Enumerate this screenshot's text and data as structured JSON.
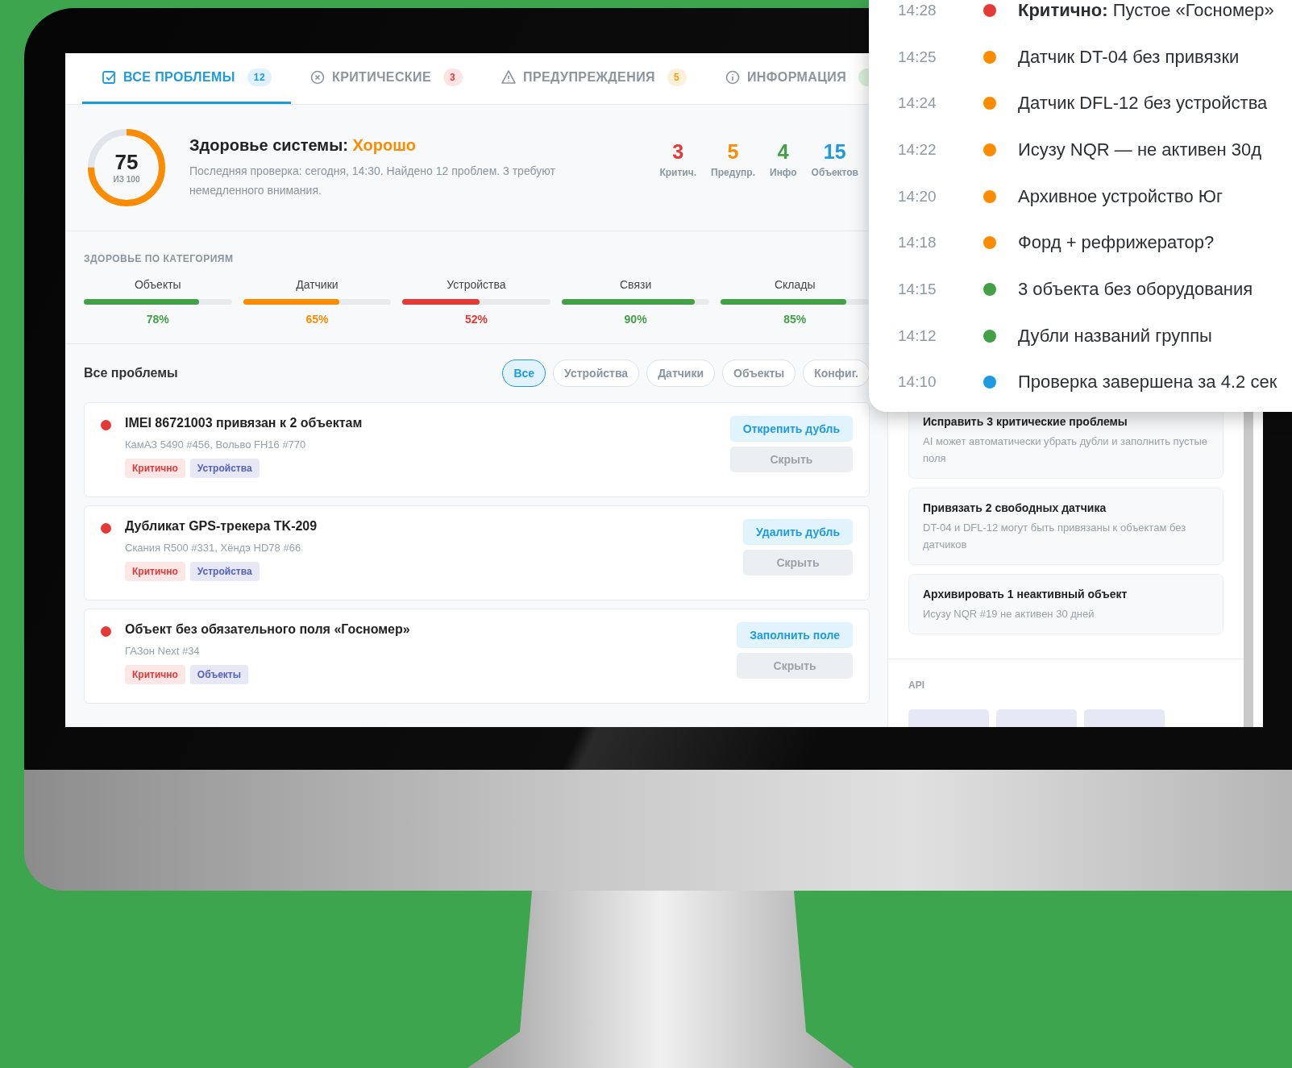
{
  "tabs": [
    {
      "label": "ВСЕ ПРОБЛЕМЫ",
      "count": "12",
      "kind": "all",
      "selected": true
    },
    {
      "label": "КРИТИЧЕСКИЕ",
      "count": "3",
      "kind": "critical",
      "selected": false
    },
    {
      "label": "ПРЕДУПРЕЖДЕНИЯ",
      "count": "5",
      "kind": "warning",
      "selected": false
    },
    {
      "label": "ИНФОРМАЦИЯ",
      "kind": "info",
      "selected": false
    }
  ],
  "health": {
    "score": "75",
    "score_caption": "ИЗ 100",
    "level": 0.75,
    "title": "Здоровье системы:",
    "status": "Хорошо",
    "description": "Последняя проверка: сегодня, 14:30. Найдено 12 проблем. 3 требуют немедленного внимания.",
    "stats": [
      {
        "value": "3",
        "label": "Критич.",
        "color": "#e53935"
      },
      {
        "value": "5",
        "label": "Предупр.",
        "color": "#fb8c00"
      },
      {
        "value": "4",
        "label": "Инфо",
        "color": "#43a047"
      },
      {
        "value": "15",
        "label": "Объектов",
        "color": "#1e9be0"
      }
    ]
  },
  "categories": {
    "title": "ЗДОРОВЬЕ ПО КАТЕГОРИЯМ",
    "items": [
      {
        "name": "Объекты",
        "level": 0.78,
        "reading": "78%",
        "color": "#43a047"
      },
      {
        "name": "Датчики",
        "level": 0.65,
        "reading": "65%",
        "color": "#fb8c00"
      },
      {
        "name": "Устройства",
        "level": 0.52,
        "reading": "52%",
        "color": "#e53935"
      },
      {
        "name": "Связи",
        "level": 0.9,
        "reading": "90%",
        "color": "#43a047"
      },
      {
        "name": "Склады",
        "level": 0.85,
        "reading": "85%",
        "color": "#43a047"
      }
    ]
  },
  "issues": {
    "title": "Все проблемы",
    "filters": [
      {
        "label": "Все",
        "selected": true
      },
      {
        "label": "Устройства",
        "selected": false
      },
      {
        "label": "Датчики",
        "selected": false
      },
      {
        "label": "Объекты",
        "selected": false
      },
      {
        "label": "Конфиг.",
        "selected": false
      }
    ],
    "items": [
      {
        "title": "IMEI 86721003 привязан к 2 объектам",
        "subtitle": "КамАЗ 5490 #456, Вольво FH16 #770",
        "color": "#e53935",
        "tags": [
          {
            "label": "Критично",
            "kind": "severity"
          },
          {
            "label": "Устройства",
            "kind": "category"
          }
        ],
        "primary_action": "Открепить дубль",
        "secondary_action": "Скрыть"
      },
      {
        "title": "Дубликат GPS-трекера TK-209",
        "subtitle": "Скания R500 #331, Хёндэ HD78 #66",
        "color": "#e53935",
        "tags": [
          {
            "label": "Критично",
            "kind": "severity"
          },
          {
            "label": "Устройства",
            "kind": "category"
          }
        ],
        "primary_action": "Удалить дубль",
        "secondary_action": "Скрыть"
      },
      {
        "title": "Объект без обязательного поля «Госномер»",
        "subtitle": "ГАЗон Next #34",
        "color": "#e53935",
        "tags": [
          {
            "label": "Критично",
            "kind": "severity"
          },
          {
            "label": "Объекты",
            "kind": "category"
          }
        ],
        "primary_action": "Заполнить поле",
        "secondary_action": "Скрыть"
      }
    ]
  },
  "sidebar": {
    "suggestions": [
      {
        "title": "Исправить 3 критические проблемы",
        "description": "AI может автоматически убрать дубли и заполнить пустые поля"
      },
      {
        "title": "Привязать 2 свободных датчика",
        "description": "DT-04 и DFL-12 могут быть привязаны к объектам без датчиков"
      },
      {
        "title": "Архивировать 1 неактивный объект",
        "description": "Исузу NQR #19 не активен 30 дней"
      }
    ],
    "api_title": "API"
  },
  "timeline": [
    {
      "time": "14:28",
      "color": "#e53935",
      "text": "**Критично:** Пустое «Госномер»"
    },
    {
      "time": "14:25",
      "color": "#fb8c00",
      "text": "Датчик DT-04 без привязки"
    },
    {
      "time": "14:24",
      "color": "#fb8c00",
      "text": "Датчик DFL-12 без устройства"
    },
    {
      "time": "14:22",
      "color": "#fb8c00",
      "text": "Исузу NQR — не активен 30д"
    },
    {
      "time": "14:20",
      "color": "#fb8c00",
      "text": "Архивное устройство Юг"
    },
    {
      "time": "14:18",
      "color": "#fb8c00",
      "text": "Форд + рефрижератор?"
    },
    {
      "time": "14:15",
      "color": "#43a047",
      "text": "3 объекта без оборудования"
    },
    {
      "time": "14:12",
      "color": "#43a047",
      "text": "Дубли названий группы"
    },
    {
      "time": "14:10",
      "color": "#1e9be0",
      "text": "Проверка завершена за 4.2 сек"
    }
  ]
}
